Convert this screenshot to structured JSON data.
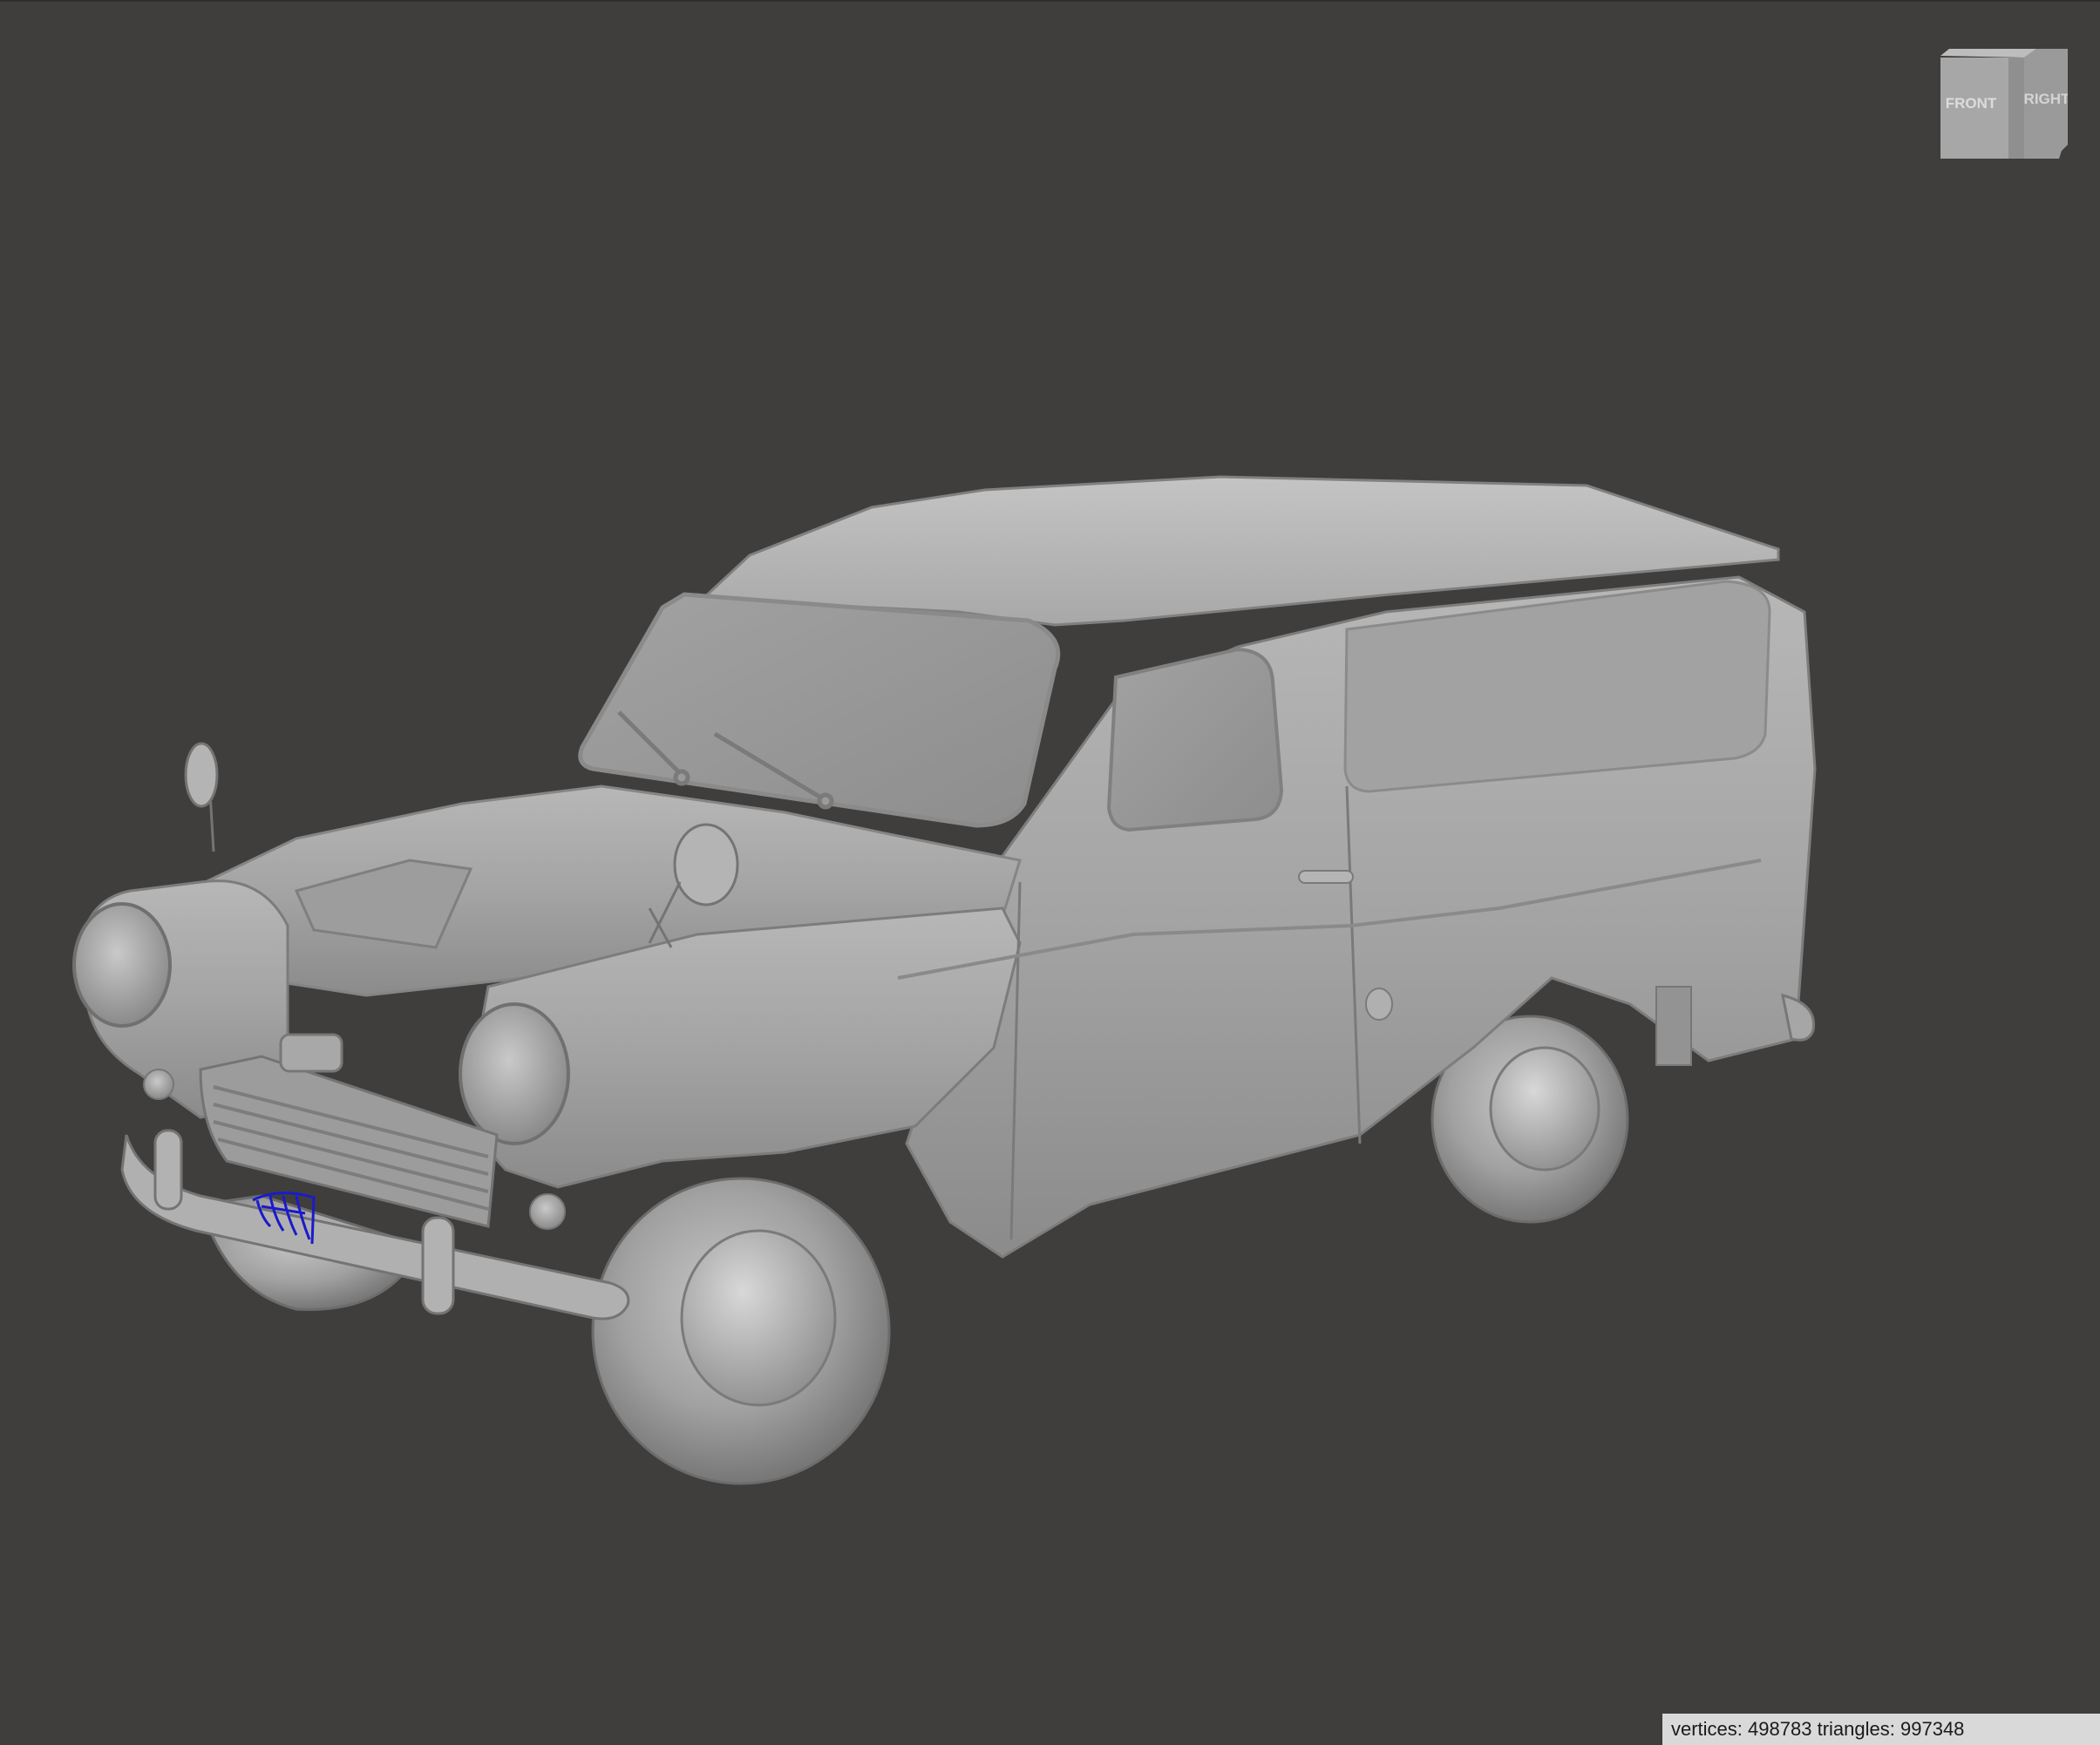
{
  "viewport": {
    "background_color": "#3f3e3c",
    "model_color": "#a9a9a9",
    "selection_color": "#1a1acc"
  },
  "nav_cube": {
    "front_label": "FRONT",
    "right_label": "RIGHT"
  },
  "status": {
    "vertices_label": "vertices:",
    "vertices_value": "498783",
    "triangles_label": "triangles:",
    "triangles_value": "997348"
  }
}
